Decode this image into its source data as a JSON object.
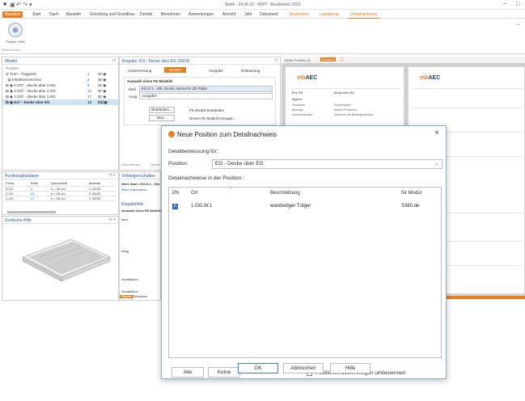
{
  "window": {
    "title": "Statik - 24.06.20 - MWT - Baubetrieb 2023",
    "controls": [
      "−",
      "□",
      "×"
    ]
  },
  "ribbon": {
    "tabs": [
      "Baustein",
      "Start",
      "Dach",
      "Bauteile",
      "Gründung und Grundbau",
      "Details",
      "Berechnen",
      "Anmerkungen",
      "Ansicht",
      "Jahr",
      "Dokument",
      "Bearbeiten",
      "Lastabtrag",
      "Detailnachweis"
    ],
    "big_button_label": "Position Hilfe",
    "group_label": "Detailnachweis"
  },
  "model_panel": {
    "title": "Modell",
    "header": "Position",
    "rows": [
      {
        "label": "TH1* - Tragwerk",
        "num": "1"
      },
      {
        "label": "Inhaltsverzeichnis",
        "num": "2"
      },
      {
        "label": "2.OG* - Decke über 3.OG",
        "num": "3"
      },
      {
        "label": "2.OG* - Decke über 2.OG",
        "num": "12"
      },
      {
        "label": "1.OG* - Decke über 1.OG",
        "num": "17"
      },
      {
        "label": "EG* - Decke über EG",
        "num": "18"
      }
    ]
  },
  "plan_panel": {
    "title": "Positionsplandaten",
    "headers": [
      "Positi..",
      "Seite",
      "Querschnitt",
      "Material"
    ],
    "rows": [
      [
        "3.OG",
        "2",
        "h = 26 cm",
        "C 20/25"
      ],
      [
        "2.OG",
        "12",
        "h = 26 cm",
        "C 20/25"
      ],
      [
        "1.OG",
        "17",
        "h = 26 cm",
        "C 20/25"
      ]
    ]
  },
  "graphic_help": {
    "title": "Grafische Hilfe"
  },
  "input_panel": {
    "title": "Eingabe: EG - Decke über EG (S819)",
    "tabs": [
      "Vorbemerkung",
      "System",
      "Ausgabe",
      "Erläuterung"
    ],
    "group_title": "Auswahl eines FE-Modells",
    "model_label": "Mod",
    "model_value": "EG.D.1 - Stb. Decke, Mono-Fe 2D Platte",
    "cut_label": "Ausg",
    "cut_value": "Ausgabel",
    "edit_button": "Bearbeiten...",
    "new_button": "Neu...",
    "edit_desc": "FE-Modell bearbeiten",
    "new_desc": "Neues FE-Modell erzeugen",
    "bottom_tabs": [
      "Übernehmen",
      "Verwerfen"
    ]
  },
  "props_panel": {
    "title": "Feldeigenschaften",
    "line1": "Wert: Mod = EG.D.1 - Stb",
    "line2": "Neue Übernahme",
    "help_title": "Eingabehilfe",
    "help_line": "Auswahl eines FE-Modells",
    "items": [
      "Mod",
      "Ausg",
      "Schalfläche",
      "Schalfläche"
    ],
    "status_tabs": [
      "Eingabe",
      "Modellinfo"
    ]
  },
  "doc_area": {
    "tab_labels": [
      "Aktive Position (1)",
      "Drucken"
    ],
    "logo_left": "mb",
    "logo_right": "AEC",
    "page_title": "Decke über EG",
    "pos_label": "Pos. EG",
    "left_labels": [
      "System",
      "Positionen",
      "Auszüge",
      "Konstruktionsart"
    ],
    "right_labels": [
      "Positionsplan",
      "Bauteil Positionen",
      "Übersicht der Bauteilpositionen"
    ]
  },
  "dialog": {
    "title": "Neue Position zum Detailnachweis",
    "section_label": "Detailbemessung für:",
    "position_label": "Position:",
    "position_value": "EG - Decke über EG",
    "list_label": "Detailnachweise in der Position:",
    "columns": [
      "J/N",
      "Ort",
      "Beschreibung",
      "für Modul"
    ],
    "rows": [
      {
        "checked": true,
        "ort": "1.OG.W.1",
        "beschreibung": "wandartiger Träger",
        "modul": "S360.de"
      }
    ],
    "btn_all": "Alle",
    "btn_none": "Keine",
    "rename_label": "Positionen beim Anlegen umbenennen",
    "btn_ok": "OK",
    "btn_cancel": "Abbrechen",
    "btn_help": "Hilfe",
    "close": "×"
  },
  "colors": {
    "accent": "#e67e22",
    "blue": "#2b5aa0",
    "selection": "#cfe3f7"
  }
}
